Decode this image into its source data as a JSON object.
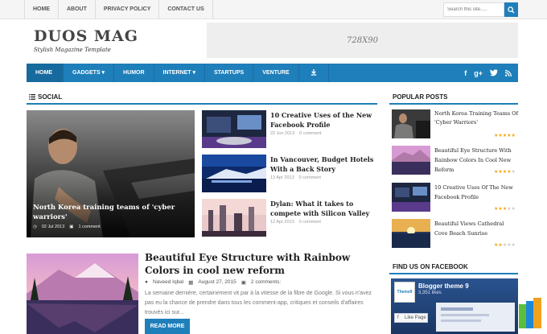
{
  "topnav": [
    "HOME",
    "ABOUT",
    "PRIVACY POLICY",
    "CONTACT US"
  ],
  "search_placeholder": "Search this site.....",
  "brand": {
    "name": "DUOS MAG",
    "tagline": "Stylish Magazine Template"
  },
  "ad_label": "728X90",
  "mainnav": {
    "items": [
      "HOME",
      "GADGETS ▾",
      "HUMOR",
      "INTERNET ▾",
      "STARTUPS",
      "VENTURE"
    ]
  },
  "social_section": {
    "title": "SOCIAL",
    "featured": {
      "title": "North Korea training teams of 'cyber warriors'",
      "date": "02 Jul 2013",
      "comments": "1 comment"
    },
    "side": [
      {
        "title": "10 Creative Uses of the New Facebook Profile",
        "date": "22 Jun 2013",
        "comments": "0 comment"
      },
      {
        "title": "In Vancouver, Budget Hotels With a Back Story",
        "date": "13 Apr 2013",
        "comments": "0 comment"
      },
      {
        "title": "Dylan: What it takes to compete with Silicon Valley",
        "date": "12 Apr 2013",
        "comments": "0 comment"
      }
    ]
  },
  "post": {
    "title": "Beautiful Eye Structure with Rainbow Colors in cool new reform",
    "author": "Naveed Iqbal",
    "date": "August 27, 2015",
    "comments": "2 comments:",
    "excerpt": "La semaine dernière, certainement vit par à la vitesse de la fibre de Google. Si vous n'avez pas eu la chance de prendre dans tous les comment-app, critiques et conseils d'affaires trouvés ici sur...",
    "read_more": "READ MORE"
  },
  "popular": {
    "title": "POPULAR POSTS",
    "items": [
      {
        "title": "North Korea Training Teams Of 'Cyber Warriors'",
        "rating": 5
      },
      {
        "title": "Beautiful Eye Structure With Rainbow Colors In Cool New Reform",
        "rating": 4
      },
      {
        "title": "10 Creative Uses Of The New Facebook Profile",
        "rating": 3
      },
      {
        "title": "Beautiful Views Cathedral Cove Beach Sunrise",
        "rating": 2
      }
    ]
  },
  "facebook": {
    "title": "FIND US ON FACEBOOK",
    "page_name": "Blogger theme 9",
    "likes": "3,351 likes",
    "like_button": "Like Page",
    "page_logo": "Theme9"
  },
  "colors": {
    "accent": "#1e7fba",
    "star": "#f3a712"
  }
}
